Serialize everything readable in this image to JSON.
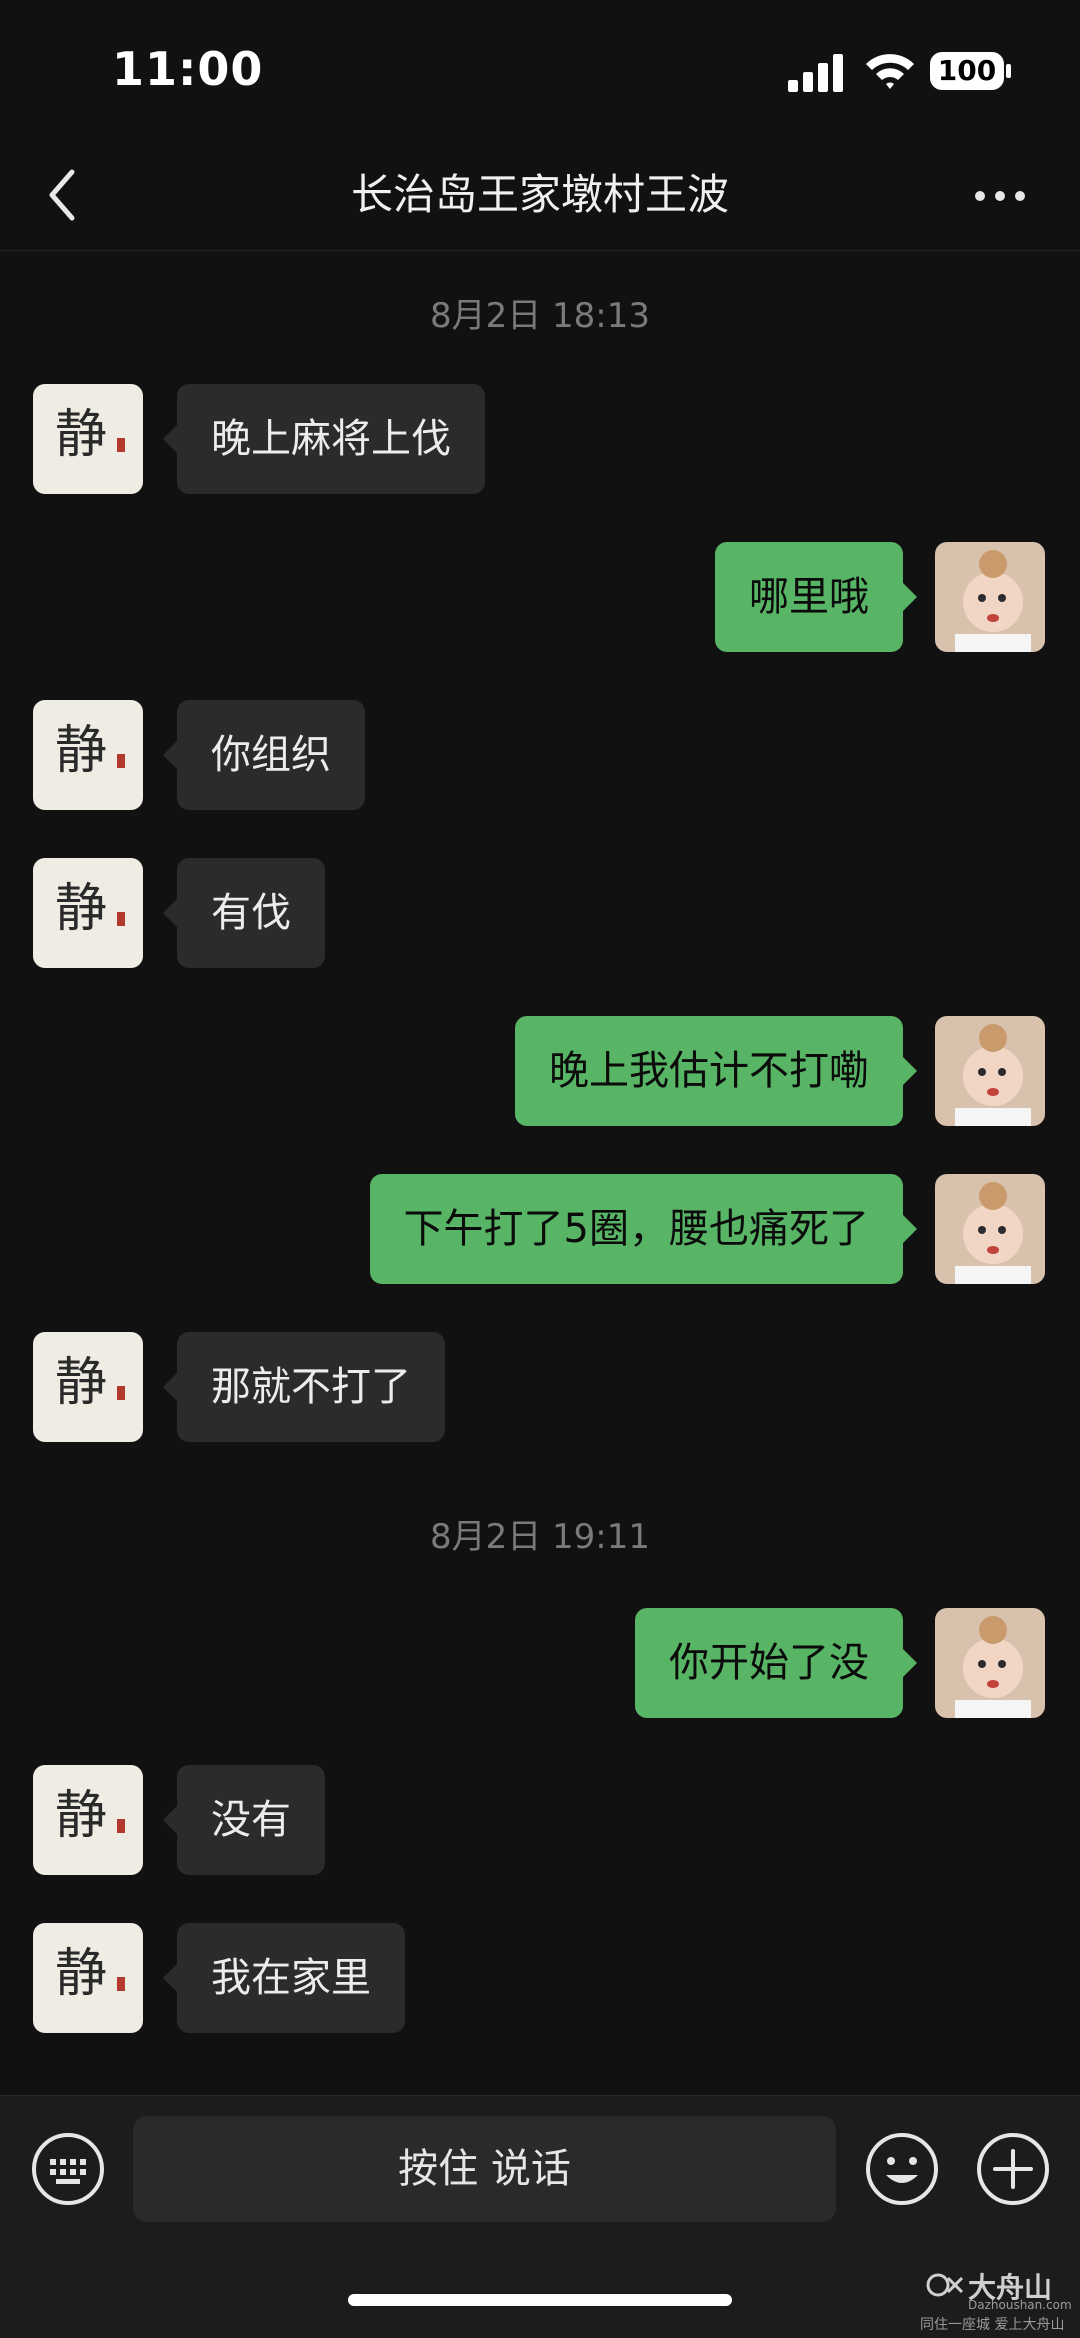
{
  "status_bar": {
    "time": "11:00",
    "battery": "100"
  },
  "nav": {
    "title": "长治岛王家墩村王波"
  },
  "timestamps": [
    "8月2日 18:13",
    "8月2日 19:11"
  ],
  "messages": [
    {
      "side": "left",
      "text": "晚上麻将上伐"
    },
    {
      "side": "right",
      "text": "哪里哦"
    },
    {
      "side": "left",
      "text": "你组织"
    },
    {
      "side": "left",
      "text": "有伐"
    },
    {
      "side": "right",
      "text": "晚上我估计不打嘞"
    },
    {
      "side": "right",
      "text": "下午打了5圈，腰也痛死了"
    },
    {
      "side": "left",
      "text": "那就不打了"
    },
    {
      "side": "right",
      "text": "你开始了没"
    },
    {
      "side": "left",
      "text": "没有"
    },
    {
      "side": "left",
      "text": "我在家里"
    }
  ],
  "avatars": {
    "contact_char": "静"
  },
  "input_bar": {
    "hold_to_talk": "按住 说话"
  },
  "watermark": {
    "brand": "大舟山",
    "url": "Dazhoushan.com",
    "tagline": "同住一座城 爱上大舟山"
  },
  "colors": {
    "background": "#111111",
    "bubble_in": "#2b2b2b",
    "bubble_out": "#57b565"
  }
}
